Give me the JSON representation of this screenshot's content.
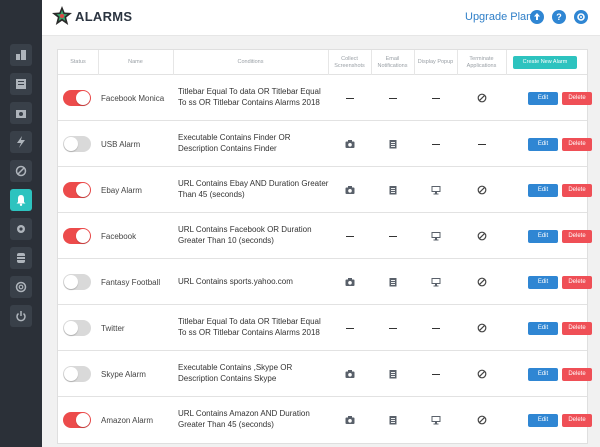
{
  "header": {
    "title": "ALARMS",
    "upgrade_label": "Upgrade Plan"
  },
  "table": {
    "headers": {
      "status": "Status",
      "name": "Name",
      "conditions": "Conditions",
      "collect_screenshots": "Collect Screenshots",
      "email_notifications": "Email Notifications",
      "display_popup": "Display Popup",
      "terminate_applications": "Terminate Applications"
    },
    "create_label": "Create New Alarm",
    "edit_label": "Edit",
    "delete_label": "Delete",
    "rows": [
      {
        "on": true,
        "name": "Facebook Monica",
        "condition": "Titlebar Equal To data OR Titlebar Equal To ss OR Titlebar Contains Alarms 2018",
        "screenshot": "dash",
        "email": "dash",
        "popup": "dash",
        "terminate": "ban"
      },
      {
        "on": false,
        "name": "USB Alarm",
        "condition": "Executable Contains Finder OR Description Contains Finder",
        "screenshot": "camera",
        "email": "mail",
        "popup": "dash",
        "terminate": "dash"
      },
      {
        "on": true,
        "name": "Ebay Alarm",
        "condition": "URL Contains Ebay AND Duration Greater Than 45 (seconds)",
        "screenshot": "camera",
        "email": "mail",
        "popup": "monitor",
        "terminate": "ban"
      },
      {
        "on": true,
        "name": "Facebook",
        "condition": "URL Contains Facebook OR Duration Greater Than 10 (seconds)",
        "screenshot": "dash",
        "email": "dash",
        "popup": "monitor",
        "terminate": "ban"
      },
      {
        "on": false,
        "name": "Fantasy Football",
        "condition": "URL Contains sports.yahoo.com",
        "screenshot": "camera",
        "email": "mail",
        "popup": "monitor",
        "terminate": "ban"
      },
      {
        "on": false,
        "name": "Twitter",
        "condition": "Titlebar Equal To data OR Titlebar Equal To ss OR Titlebar Contains Alarms 2018",
        "screenshot": "dash",
        "email": "dash",
        "popup": "dash",
        "terminate": "ban"
      },
      {
        "on": false,
        "name": "Skype Alarm",
        "condition": "Executable Contains ,Skype OR Description Contains Skype",
        "screenshot": "camera",
        "email": "mail",
        "popup": "dash",
        "terminate": "ban"
      },
      {
        "on": true,
        "name": "Amazon Alarm",
        "condition": "URL Contains Amazon AND Duration Greater Than 45 (seconds)",
        "screenshot": "camera",
        "email": "mail",
        "popup": "monitor",
        "terminate": "ban"
      }
    ]
  },
  "sidebar": {
    "items": [
      {
        "icon": "dashboard-icon",
        "active": false
      },
      {
        "icon": "reports-icon",
        "active": false
      },
      {
        "icon": "screenshots-icon",
        "active": false
      },
      {
        "icon": "activity-icon",
        "active": false
      },
      {
        "icon": "block-icon",
        "active": false
      },
      {
        "icon": "alarm-bell-icon",
        "active": true
      },
      {
        "icon": "settings-icon",
        "active": false
      },
      {
        "icon": "database-icon",
        "active": false
      },
      {
        "icon": "support-icon",
        "active": false
      },
      {
        "icon": "power-icon",
        "active": false
      }
    ]
  },
  "colors": {
    "accent": "#2dc3bf",
    "toggle_on": "#ec4b4b",
    "edit": "#2f86d3",
    "delete": "#ef4f56",
    "sidebar": "#2b3038"
  }
}
